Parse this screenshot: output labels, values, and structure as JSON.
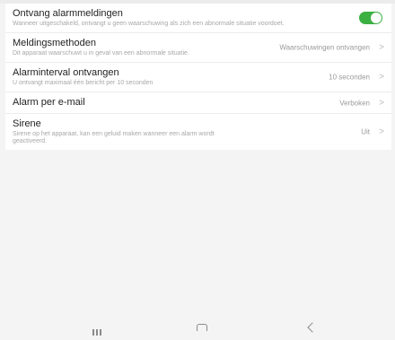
{
  "settings": {
    "rows": [
      {
        "title": "Ontvang alarmmeldingen",
        "desc": "Wanneer uitgeschakeld, ontvangt u geen waarschuwing als zich een abnormale situatie voordoet.",
        "toggle_on": true,
        "accent": "#3cb043"
      },
      {
        "title": "Meldingsmethoden",
        "desc": "Dit apparaat waarschuwt u in geval van een abnormale situatie.",
        "value": "Waarschuwingen ontvangen",
        "chevron": ">"
      },
      {
        "title": "Alarminterval ontvangen",
        "desc": "U ontvangt maximaal één bericht per 10 seconden",
        "value": "10 seconden",
        "chevron": ">"
      },
      {
        "title": "Alarm per e-mail",
        "value": "Verboken",
        "chevron": ">"
      },
      {
        "title": "Sirene",
        "desc": "Sirene op het apparaat, kan een geluid maken wanneer een alarm wordt geactiveerd.",
        "value": "Uit",
        "chevron": ">"
      }
    ]
  },
  "navbar": {
    "icons": [
      "recent-apps-icon",
      "home-icon",
      "back-icon"
    ]
  }
}
